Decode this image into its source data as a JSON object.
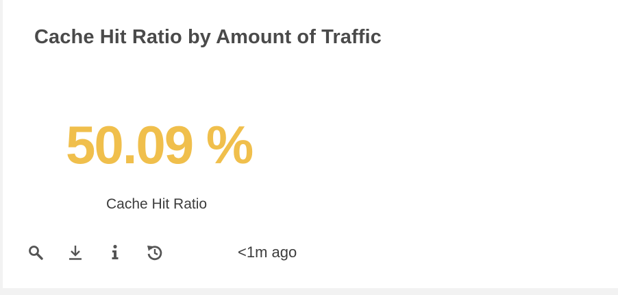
{
  "panel": {
    "title": "Cache Hit Ratio by Amount of Traffic",
    "single_value": "50.09 %",
    "value_label": "Cache Hit Ratio",
    "value_color": "#f0bf4c"
  },
  "toolbar": {
    "icons": [
      "search-icon",
      "download-icon",
      "info-icon",
      "refresh-icon"
    ],
    "timestamp": "<1m ago"
  }
}
